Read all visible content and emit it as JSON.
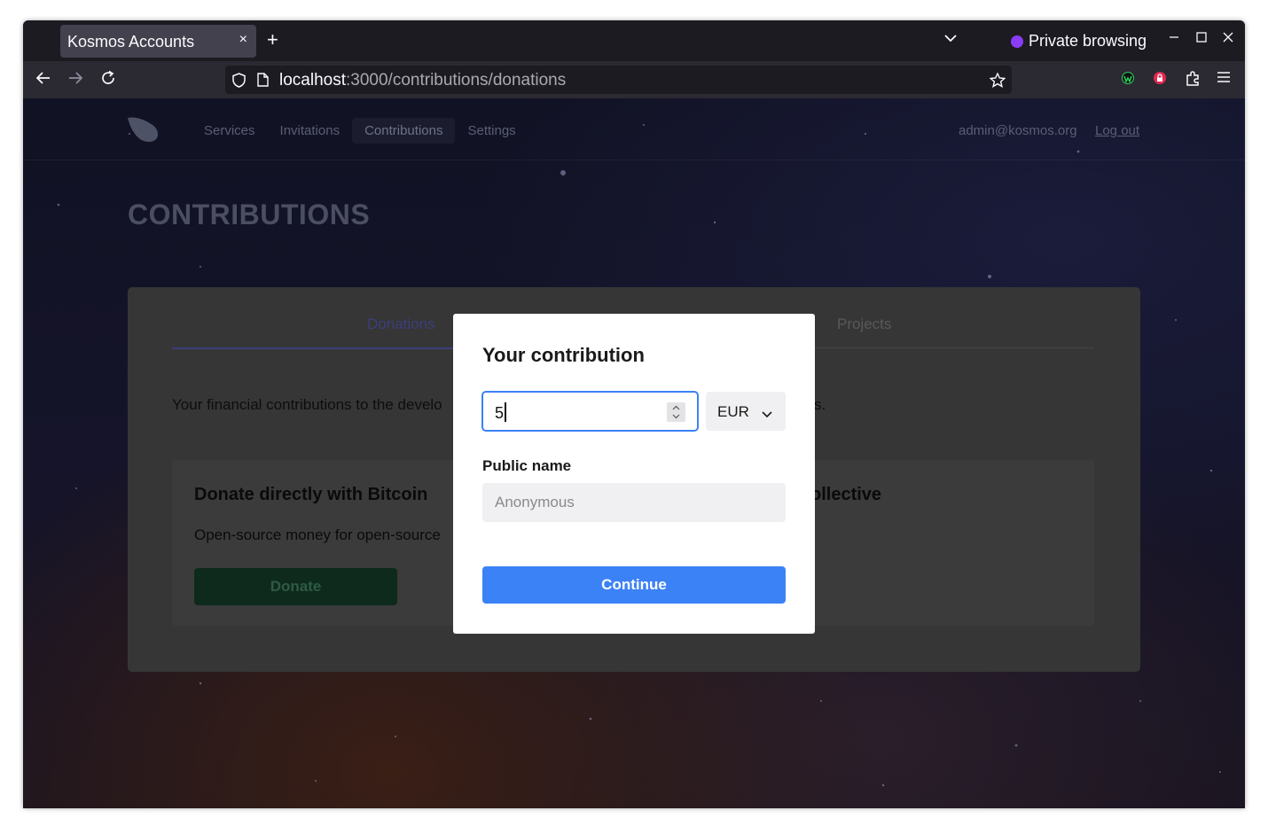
{
  "browser": {
    "tab_title": "Kosmos Accounts",
    "tab_close": "×",
    "new_tab": "+",
    "private_label": "Private browsing",
    "url_host": "localhost",
    "url_path": ":3000/contributions/donations"
  },
  "site": {
    "nav": [
      "Services",
      "Invitations",
      "Contributions",
      "Settings"
    ],
    "user_email": "admin@kosmos.org",
    "logout": "Log out",
    "page_title": "CONTRIBUTIONS"
  },
  "card": {
    "tabs": [
      "Donations",
      "Projects"
    ],
    "description_start": "Your financial contributions to the develo",
    "description_end": "s.",
    "donate_title": "Donate directly with Bitcoin",
    "donate_title_2": "ollective",
    "donate_text": "Open-source money for open-source",
    "donate_button": "Donate"
  },
  "modal": {
    "title": "Your contribution",
    "amount_value": "5",
    "currency": "EUR",
    "public_name_label": "Public name",
    "public_name_placeholder": "Anonymous",
    "continue_button": "Continue"
  },
  "colors": {
    "accent": "#3b82f6",
    "browser_bg": "#1c1b22",
    "private_purple": "#8b3cf6"
  }
}
